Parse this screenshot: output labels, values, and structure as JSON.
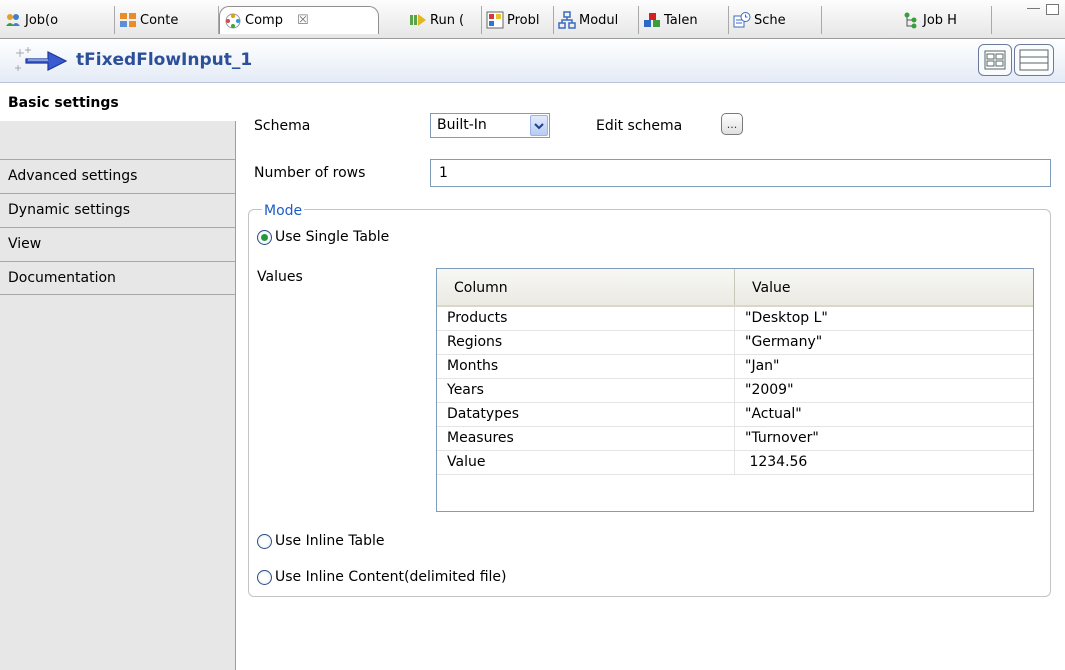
{
  "tabs": [
    {
      "label": "Job(o",
      "icon": "job-icon"
    },
    {
      "label": "Conte",
      "icon": "context-icon"
    },
    {
      "label": "Comp",
      "icon": "component-icon",
      "active": true
    },
    {
      "label": "Run (",
      "icon": "run-icon"
    },
    {
      "label": "Probl",
      "icon": "problems-icon"
    },
    {
      "label": "Modul",
      "icon": "modules-icon"
    },
    {
      "label": "Talen",
      "icon": "talend-icon"
    },
    {
      "label": "Sche",
      "icon": "scheduler-icon"
    },
    {
      "label": "Job H",
      "icon": "job-hierarchy-icon"
    }
  ],
  "header": {
    "title": "tFixedFlowInput_1"
  },
  "nav": {
    "items": [
      {
        "label": "Basic settings"
      },
      {
        "label": "Advanced settings"
      },
      {
        "label": "Dynamic settings"
      },
      {
        "label": "View"
      },
      {
        "label": "Documentation"
      }
    ]
  },
  "form": {
    "schema_label": "Schema",
    "schema_value": "Built-In",
    "edit_schema_label": "Edit schema",
    "edit_schema_button": "...",
    "rows_label": "Number of rows",
    "rows_value": "1",
    "mode_legend": "Mode",
    "radio_single": "Use Single Table",
    "values_label": "Values",
    "radio_inline_table": "Use Inline Table",
    "radio_inline_content": "Use Inline Content(delimited file)"
  },
  "table": {
    "headers": [
      "Column",
      "Value"
    ],
    "rows": [
      [
        "Products",
        "\"Desktop L\""
      ],
      [
        "Regions",
        "\"Germany\""
      ],
      [
        "Months",
        "\"Jan\""
      ],
      [
        "Years",
        "\"2009\""
      ],
      [
        "Datatypes",
        "\"Actual\""
      ],
      [
        "Measures",
        "\"Turnover\""
      ],
      [
        "Value",
        " 1234.56"
      ]
    ]
  }
}
